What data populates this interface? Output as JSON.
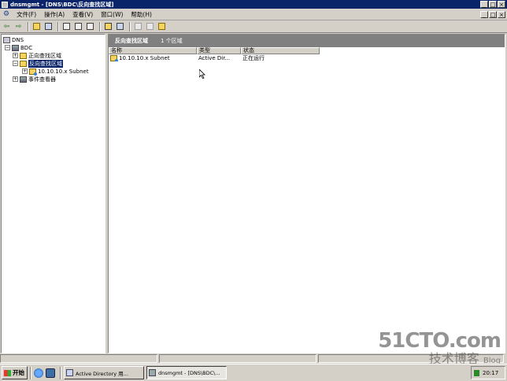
{
  "window": {
    "title": "dnsmgmt - [DNS\\BDC\\反向查找区域]"
  },
  "menu": {
    "items": [
      "文件(F)",
      "操作(A)",
      "查看(V)",
      "窗口(W)",
      "帮助(H)"
    ]
  },
  "toolbar": {
    "icons": [
      "back-icon",
      "forward-icon",
      "up-folder-icon",
      "show-tree-icon",
      "properties-icon",
      "refresh-icon",
      "export-list-icon",
      "help-icon",
      "console-icon",
      "new-zone-icon",
      "server-icon",
      "tools-icon",
      "update-icon"
    ]
  },
  "tree": {
    "root": "DNS",
    "server": "BDC",
    "forward_zones": "正向查找区域",
    "reverse_zones": "反向查找区域",
    "reverse_child": "10.10.10.x Subnet",
    "event_viewer": "事件查看器"
  },
  "list": {
    "header_title": "反向查找区域",
    "header_count": "1 个区域",
    "columns": [
      "名称",
      "类型",
      "状态"
    ],
    "rows": [
      {
        "name": "10.10.10.x Subnet",
        "type": "Active Dir...",
        "status": "正在运行"
      }
    ]
  },
  "taskbar": {
    "start_label": "开始",
    "tasks": [
      {
        "label": "Active Directory 用...",
        "active": false
      },
      {
        "label": "dnsmgmt - [DNS\\BDC\\...",
        "active": true
      }
    ],
    "clock": "20:17"
  },
  "watermark": {
    "main": "51CTO.com",
    "sub": "技术博客",
    "blog": "Blog"
  },
  "colors": {
    "titlebar": "#0a246a",
    "selection": "#0a246a",
    "list_header": "#808080",
    "face": "#d4d0c8"
  }
}
